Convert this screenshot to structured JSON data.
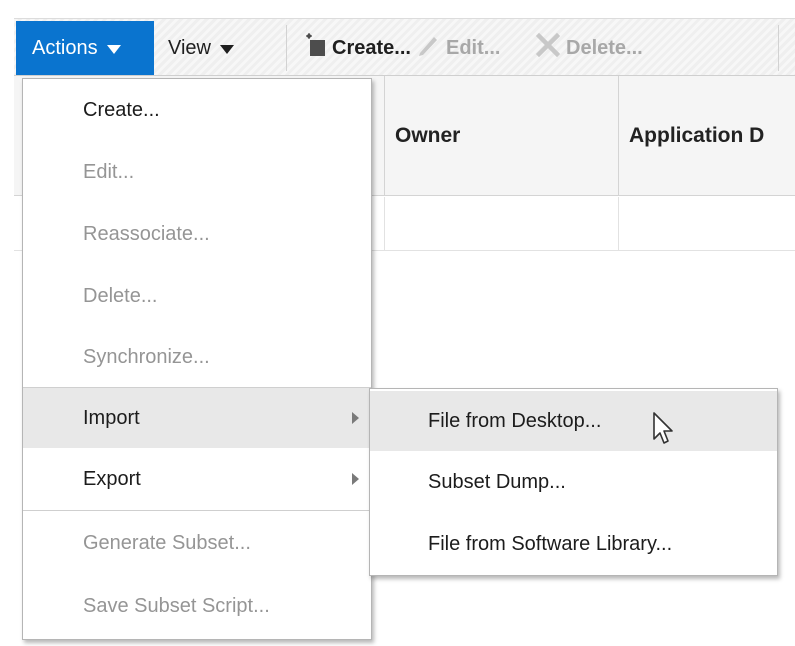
{
  "toolbar": {
    "actions_label": "Actions",
    "view_label": "View",
    "create_label": "Create...",
    "edit_label": "Edit...",
    "delete_label": "Delete..."
  },
  "table": {
    "columns": [
      "Owner",
      "Application D"
    ]
  },
  "actions_menu": {
    "items": [
      {
        "label": "Create...",
        "enabled": true
      },
      {
        "label": "Edit...",
        "enabled": false
      },
      {
        "label": "Reassociate...",
        "enabled": false
      },
      {
        "label": "Delete...",
        "enabled": false
      },
      {
        "label": "Synchronize...",
        "enabled": false
      },
      {
        "label": "Import",
        "enabled": true,
        "submenu": true,
        "highlighted": true
      },
      {
        "label": "Export",
        "enabled": true,
        "submenu": true
      },
      {
        "label": "Generate Subset...",
        "enabled": false
      },
      {
        "label": "Save Subset Script...",
        "enabled": false
      }
    ]
  },
  "import_submenu": {
    "items": [
      {
        "label": "File from Desktop...",
        "highlighted": true
      },
      {
        "label": "Subset Dump..."
      },
      {
        "label": "File from Software Library..."
      }
    ]
  },
  "colors": {
    "accent": "#0a74cf",
    "disabled_text": "#959595",
    "hover_background": "#e8e8e8"
  },
  "icons": {
    "create": "new-item-icon",
    "edit": "pencil-icon",
    "delete": "x-delete-icon",
    "submenu": "chevron-right-icon",
    "pointer": "mouse-pointer-icon"
  }
}
